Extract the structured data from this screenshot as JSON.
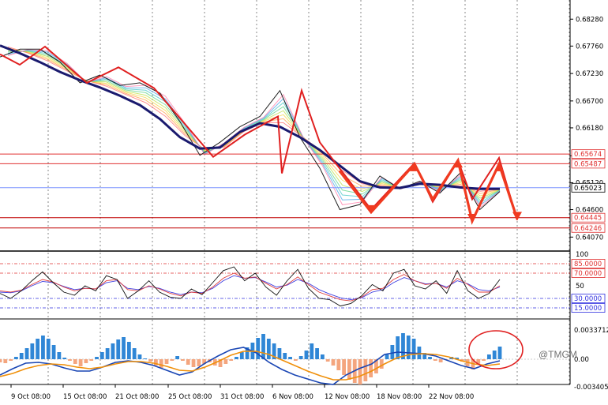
{
  "chart_data": [
    {
      "type": "line",
      "panel": "price",
      "x_labels": [
        "9 Oct 08:00",
        "15 Oct 08:00",
        "21 Oct 08:00",
        "25 Oct 08:00",
        "31 Oct 08:00",
        "6 Nov 08:00",
        "12 Nov 08:00",
        "18 Nov 08:00",
        "22 Nov 08:00"
      ],
      "ylim": [
        0.638,
        0.6865
      ],
      "y_ticks": [
        "0.68280",
        "0.67760",
        "0.67230",
        "0.66700",
        "0.66180",
        "0.65640",
        "0.65120",
        "0.64600",
        "0.64070"
      ],
      "levels": [
        {
          "label": "0.65674",
          "value": 0.65674,
          "color": "#e03030"
        },
        {
          "label": "0.65487",
          "value": 0.65487,
          "color": "#e03030"
        },
        {
          "label": "0.65023",
          "value": 0.65023,
          "color": "#7f95ff"
        },
        {
          "label": "0.64445",
          "value": 0.64445,
          "color": "#c00000"
        },
        {
          "label": "0.64246",
          "value": 0.64246,
          "color": "#c00000"
        }
      ],
      "series": [
        {
          "role": "moving-average",
          "color": "#1a1a6e",
          "values": [
            0.6777,
            0.6762,
            0.6745,
            0.6726,
            0.671,
            0.6696,
            0.668,
            0.6662,
            0.6635,
            0.66,
            0.6578,
            0.658,
            0.661,
            0.6627,
            0.662,
            0.66,
            0.6575,
            0.6545,
            0.6515,
            0.6503,
            0.6502,
            0.651,
            0.6508,
            0.6503,
            0.65,
            0.65
          ]
        },
        {
          "role": "price",
          "color": "#202020",
          "values": [
            0.6755,
            0.677,
            0.677,
            0.6745,
            0.6705,
            0.672,
            0.67,
            0.6705,
            0.6685,
            0.663,
            0.6565,
            0.659,
            0.662,
            0.664,
            0.669,
            0.66,
            0.654,
            0.646,
            0.647,
            0.6525,
            0.65,
            0.6515,
            0.6492,
            0.653,
            0.646,
            0.6495
          ]
        }
      ],
      "zigzag": {
        "color": "#e02020",
        "values": [
          0.676,
          0.674,
          0.6775,
          0.6705,
          0.6735,
          0.6695,
          0.6562,
          0.6605,
          0.664,
          0.653,
          0.669,
          0.659,
          0.646,
          0.655,
          0.6475,
          0.6555,
          0.648,
          0.656,
          0.644,
          0.655,
          0.6435
        ]
      }
    },
    {
      "type": "line",
      "panel": "oscillator",
      "ylim": [
        0,
        100
      ],
      "y_ticks": [
        "100",
        "50"
      ],
      "levels": [
        {
          "label": "85.0000",
          "value": 85,
          "color": "#e03030"
        },
        {
          "label": "70.0000",
          "value": 70,
          "color": "#e03030"
        },
        {
          "label": "30.0000",
          "value": 30,
          "color": "#3030e0"
        },
        {
          "label": "15.0000",
          "value": 15,
          "color": "#3030e0"
        }
      ],
      "series": [
        {
          "role": "fast",
          "color": "#111111",
          "values": [
            38,
            30,
            42,
            58,
            72,
            55,
            40,
            35,
            50,
            42,
            66,
            60,
            30,
            42,
            58,
            40,
            32,
            30,
            45,
            36,
            55,
            74,
            80,
            58,
            70,
            48,
            35,
            58,
            76,
            46,
            30,
            28,
            18,
            22,
            34,
            52,
            42,
            70,
            76,
            50,
            45,
            58,
            38,
            74,
            42,
            30,
            38,
            60
          ]
        },
        {
          "role": "slow",
          "color": "#e04040",
          "values": [
            42,
            40,
            43,
            52,
            60,
            56,
            48,
            42,
            46,
            45,
            58,
            60,
            44,
            42,
            50,
            45,
            38,
            34,
            40,
            38,
            48,
            62,
            70,
            62,
            64,
            54,
            45,
            52,
            64,
            52,
            40,
            34,
            28,
            26,
            32,
            44,
            46,
            60,
            68,
            58,
            52,
            54,
            46,
            62,
            52,
            40,
            40,
            50
          ]
        },
        {
          "role": "signal",
          "color": "#4040e0",
          "values": [
            40,
            39,
            42,
            50,
            57,
            55,
            49,
            44,
            46,
            45,
            55,
            58,
            46,
            44,
            49,
            46,
            40,
            36,
            40,
            39,
            46,
            58,
            66,
            62,
            63,
            56,
            48,
            51,
            60,
            54,
            44,
            37,
            31,
            28,
            31,
            40,
            44,
            55,
            63,
            58,
            53,
            54,
            48,
            58,
            53,
            44,
            42,
            48
          ]
        }
      ]
    },
    {
      "type": "bar",
      "panel": "macd",
      "y_ticks": [
        "0.0033712",
        "0.00",
        "-0.003405"
      ],
      "histogram": {
        "pos_color": "#2f86d6",
        "neg_color": "#f4a57e",
        "values": [
          -0.4,
          -0.5,
          -0.2,
          0.3,
          0.8,
          1.4,
          2.0,
          2.6,
          3.0,
          2.6,
          1.8,
          0.9,
          0.2,
          -0.2,
          -0.6,
          -0.9,
          -0.5,
          -0.2,
          0.3,
          0.9,
          1.4,
          2.0,
          2.5,
          2.8,
          2.2,
          1.4,
          0.6,
          0.1,
          -0.3,
          -0.8,
          -1.1,
          -0.6,
          -0.2,
          0.4,
          -0.2,
          -0.7,
          -1.0,
          -0.9,
          -0.6,
          -0.4,
          -0.8,
          -1.0,
          -0.6,
          -0.2,
          0.3,
          0.9,
          1.5,
          2.1,
          2.7,
          3.2,
          2.6,
          2.0,
          1.4,
          0.8,
          0.3,
          -0.2,
          0.4,
          1.1,
          2.0,
          1.4,
          0.6,
          -0.3,
          -0.8,
          -1.4,
          -2.0,
          -2.6,
          -3.0,
          -3.2,
          -2.8,
          -2.3,
          -1.8,
          -1.2,
          0.6,
          1.8,
          2.9,
          3.3,
          3.0,
          2.6,
          1.6,
          0.8,
          0.3,
          -0.2,
          -0.4,
          -0.1,
          0.3,
          0.2,
          -0.3,
          -0.9,
          -1.3,
          -0.7,
          -0.2,
          0.6,
          1.1,
          1.6
        ]
      },
      "series": [
        {
          "role": "macd",
          "color": "#1a46b4",
          "values": [
            -2.0,
            -1.2,
            -0.5,
            -0.4,
            -0.6,
            -1.1,
            -1.5,
            -1.5,
            -1.0,
            -0.4,
            -0.2,
            -0.4,
            -0.8,
            -1.4,
            -2.0,
            -1.6,
            -0.5,
            0.4,
            1.2,
            1.5,
            0.8,
            -0.4,
            -1.3,
            -2.0,
            -2.5,
            -3.0,
            -3.2,
            -2.0,
            -1.2,
            -0.6,
            0.6,
            0.9,
            0.8,
            0.7,
            0.4,
            -0.2,
            -0.8,
            -1.2,
            -0.6,
            -0.2
          ]
        },
        {
          "role": "signal",
          "color": "#f0900a",
          "values": [
            -2.2,
            -1.8,
            -1.2,
            -0.8,
            -0.6,
            -0.7,
            -1.0,
            -1.2,
            -1.0,
            -0.6,
            -0.3,
            -0.3,
            -0.5,
            -0.9,
            -1.4,
            -1.5,
            -1.0,
            -0.3,
            0.5,
            1.0,
            1.0,
            0.6,
            -0.1,
            -0.8,
            -1.5,
            -2.1,
            -2.6,
            -2.6,
            -2.2,
            -1.5,
            -0.6,
            0.2,
            0.6,
            0.7,
            0.6,
            0.3,
            -0.2,
            -0.6,
            -0.8,
            -0.6
          ]
        }
      ]
    }
  ],
  "watermark": "@TMGM",
  "colors": {
    "grid": "#000000",
    "annotation": "#e02020",
    "highlight_circle": "#e02020"
  }
}
